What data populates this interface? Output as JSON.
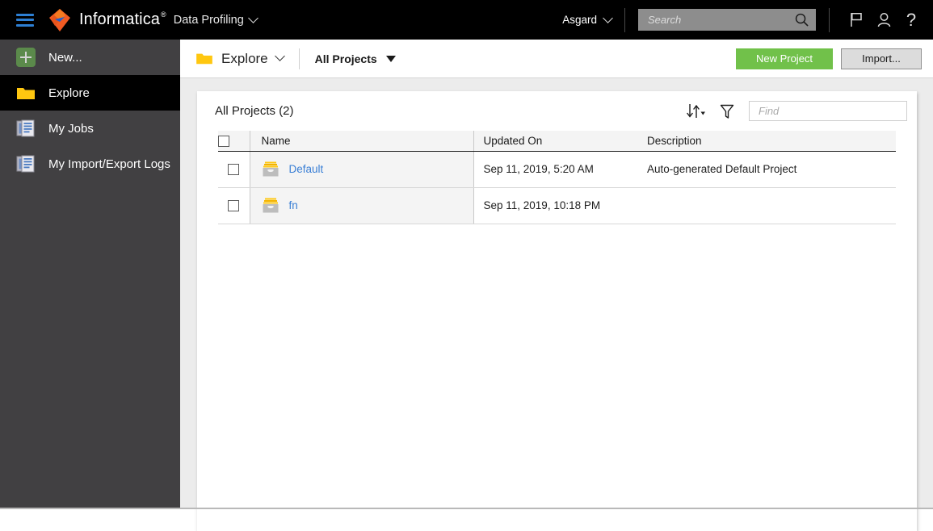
{
  "header": {
    "menu_icon": "hamburger-menu-icon",
    "brand": "Informatica",
    "brand_tm": "®",
    "app_name": "Data Profiling",
    "app_chevron": "chevron-down-icon",
    "org": "Asgard",
    "org_chevron": "chevron-down-icon",
    "search": {
      "value": "",
      "placeholder": "Search",
      "icon": "search-icon"
    },
    "icons": [
      {
        "name": "flag-icon",
        "label": "Flag"
      },
      {
        "name": "user-icon",
        "label": "User"
      },
      {
        "name": "help-icon",
        "label": "?"
      }
    ]
  },
  "sidebar": {
    "items": [
      {
        "label": "New...",
        "icon": "plus-square-icon",
        "active": false
      },
      {
        "label": "Explore",
        "icon": "folder-icon",
        "active": true
      },
      {
        "label": "My Jobs",
        "icon": "documents-icon",
        "active": false
      },
      {
        "label": "My Import/Export Logs",
        "icon": "documents-icon",
        "active": false
      }
    ]
  },
  "toolbar": {
    "explore_label": "Explore",
    "explore_icon": "folder-icon",
    "explore_chevron": "chevron-down-icon",
    "scope_label": "All Projects",
    "scope_caret": "triangle-down-icon",
    "new_project_label": "New Project",
    "import_label": "Import...",
    "accent_green": "#71c14a",
    "button_gray": "#dcdcdc"
  },
  "panel": {
    "title": "All Projects (2)",
    "sort_icon": "sort-arrows-icon",
    "filter_icon": "funnel-filter-icon",
    "find": {
      "value": "",
      "placeholder": "Find"
    }
  },
  "table": {
    "select_all_checkbox": "",
    "columns": [
      "Name",
      "Updated On",
      "Description"
    ],
    "rows": [
      {
        "checked": false,
        "icon": "project-box-icon",
        "name": "Default",
        "updated_on": "Sep 11, 2019, 5:20 AM",
        "description": "Auto-generated Default Project"
      },
      {
        "checked": false,
        "icon": "project-box-icon",
        "name": "fn",
        "updated_on": "Sep 11, 2019, 10:18 PM",
        "description": ""
      }
    ]
  },
  "colors": {
    "topbar_bg": "#000000",
    "sidebar_bg": "#414042",
    "sidebar_active_bg": "#000000",
    "link_blue": "#3a7fd5",
    "folder_yellow": "#ffc710",
    "logo_orange": "#f15a22",
    "logo_blue": "#1d5fd0"
  }
}
